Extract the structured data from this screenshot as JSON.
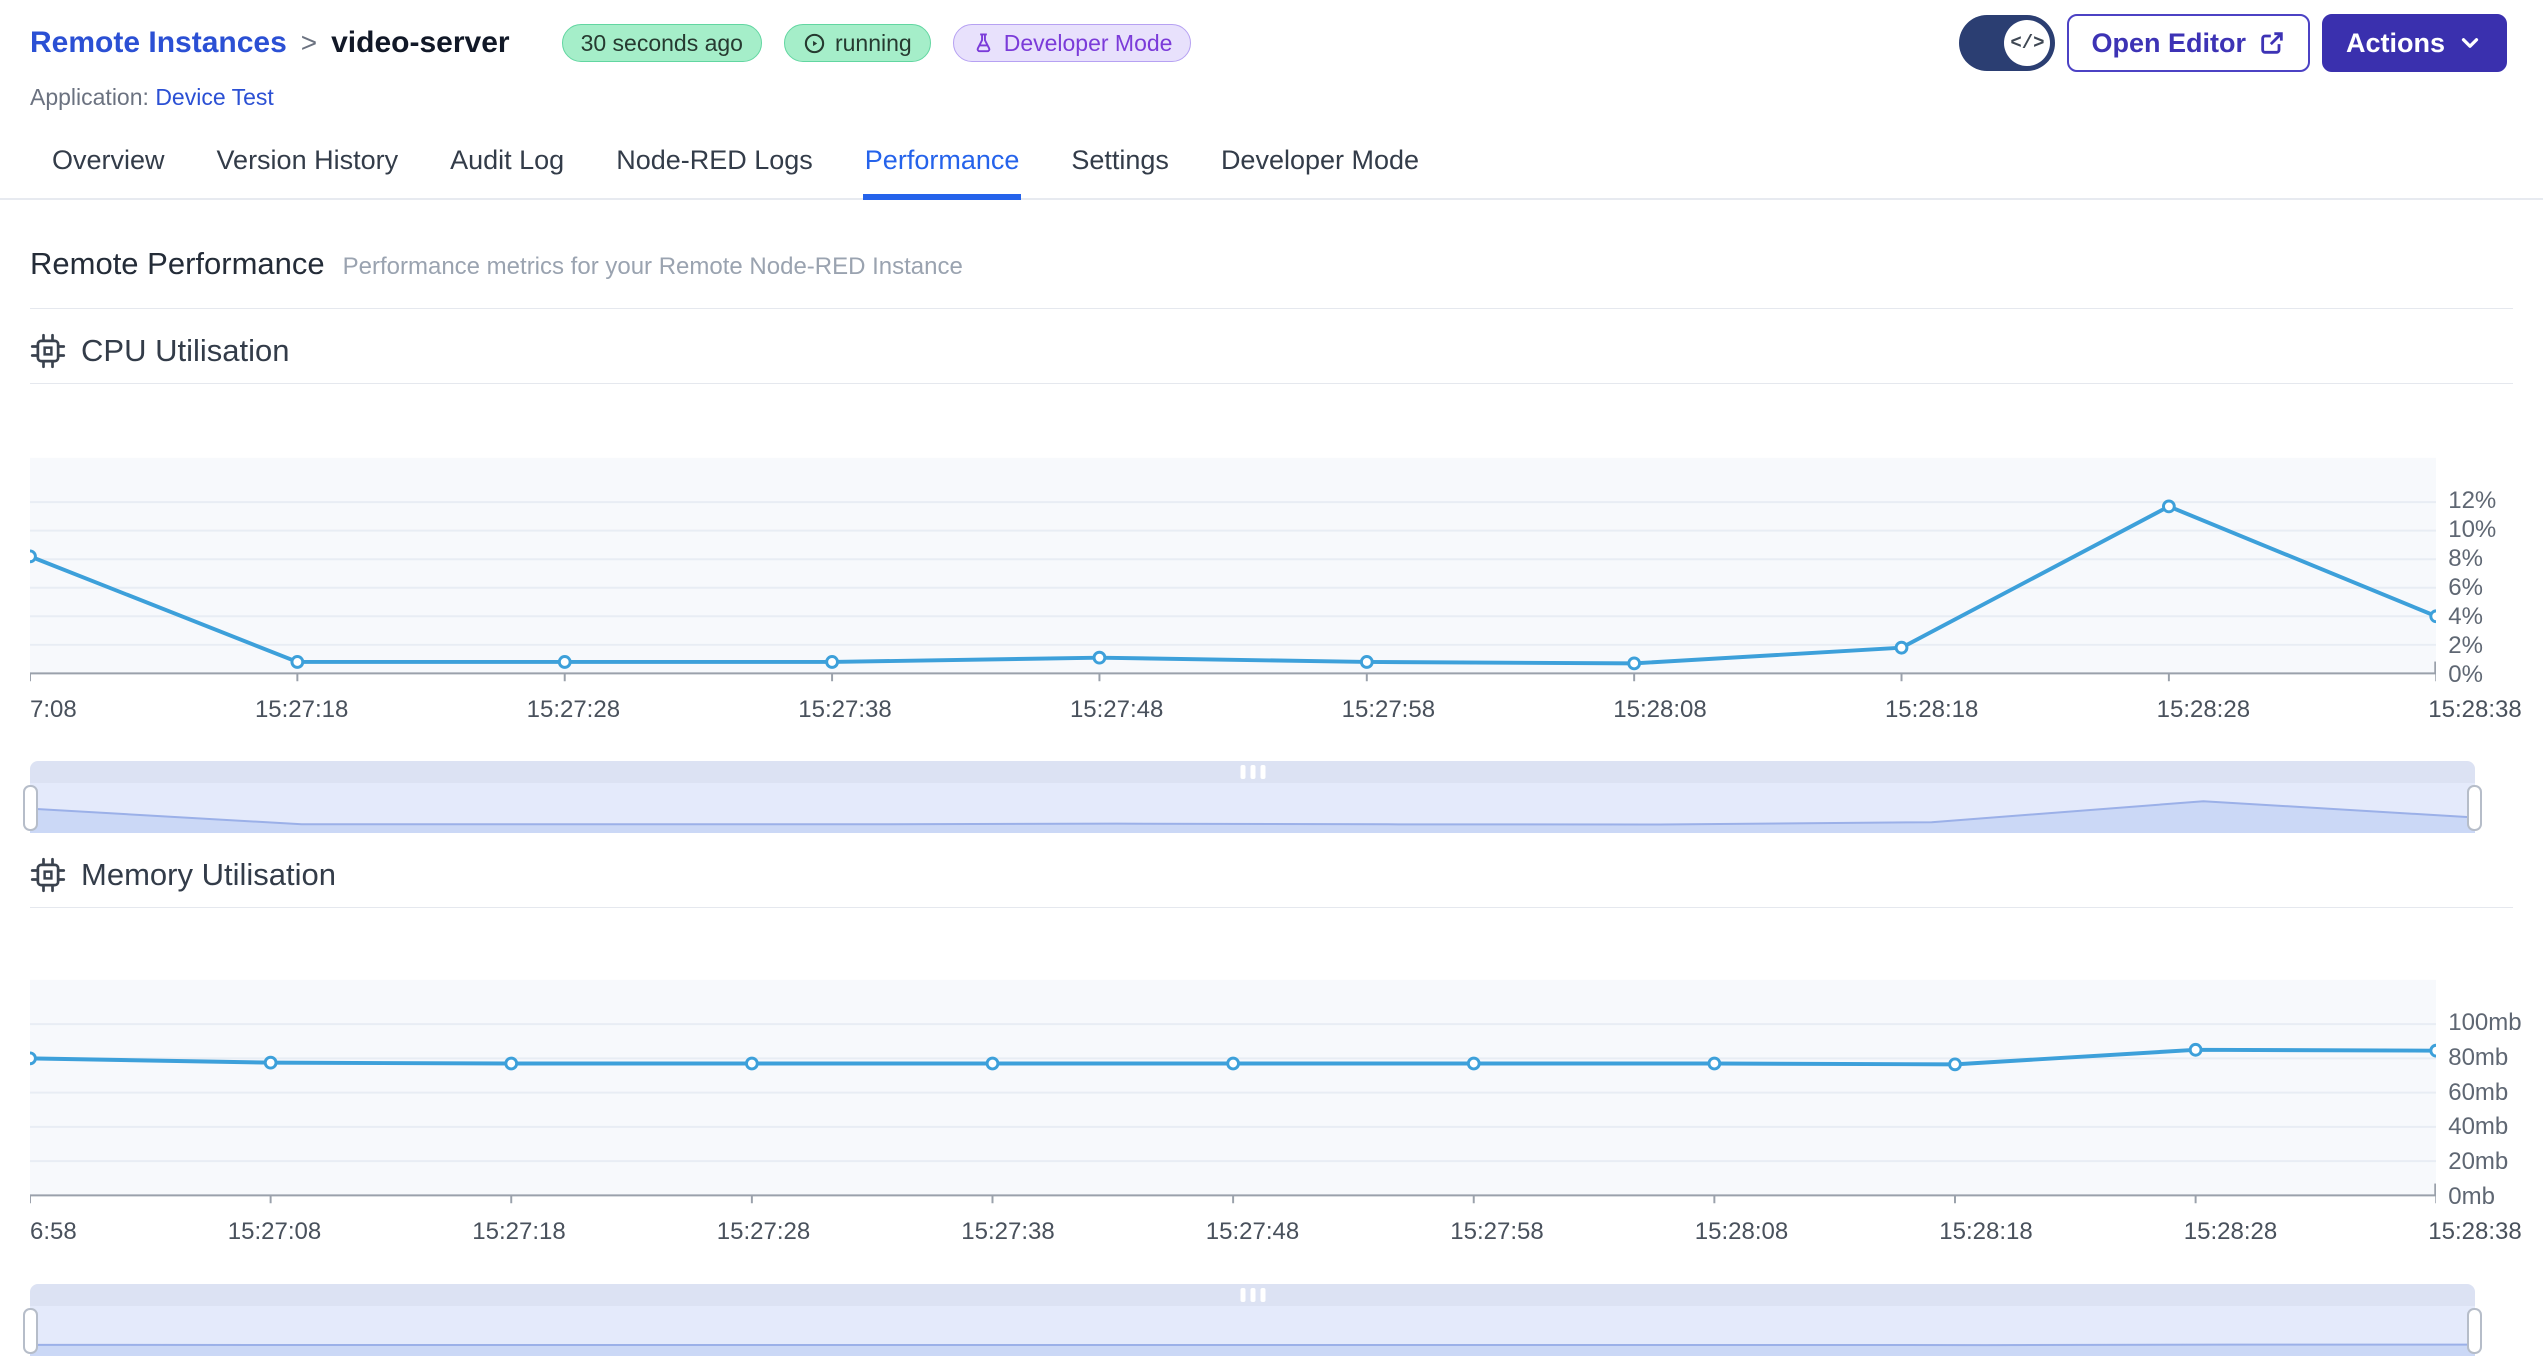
{
  "header": {
    "breadcrumb": {
      "parent": "Remote Instances",
      "separator": ">",
      "current": "video-server"
    },
    "badges": {
      "last_seen": "30 seconds ago",
      "status": "running",
      "mode": "Developer Mode"
    },
    "application_label": "Application:",
    "application_name": "Device Test",
    "open_editor_label": "Open Editor",
    "actions_label": "Actions"
  },
  "icons": {
    "toggle_code_glyph": "</>"
  },
  "tabs": [
    {
      "label": "Overview",
      "active": false
    },
    {
      "label": "Version History",
      "active": false
    },
    {
      "label": "Audit Log",
      "active": false
    },
    {
      "label": "Node-RED Logs",
      "active": false
    },
    {
      "label": "Performance",
      "active": true
    },
    {
      "label": "Settings",
      "active": false
    },
    {
      "label": "Developer Mode",
      "active": false
    }
  ],
  "page": {
    "title": "Remote Performance",
    "subtitle": "Performance metrics for your Remote Node-RED Instance"
  },
  "sections": {
    "cpu": {
      "title": "CPU Utilisation"
    },
    "memory": {
      "title": "Memory Utilisation"
    }
  },
  "chart_data": [
    {
      "id": "cpu",
      "type": "line",
      "title": "CPU Utilisation",
      "x_tick_labels": [
        "7:08",
        "15:27:18",
        "15:27:28",
        "15:27:38",
        "15:27:48",
        "15:27:58",
        "15:28:08",
        "15:28:18",
        "15:28:28",
        "15:28:38"
      ],
      "values": [
        8.2,
        0.8,
        0.8,
        0.8,
        1.1,
        0.8,
        0.7,
        1.8,
        11.7,
        4.0
      ],
      "unit": "%",
      "ylim": [
        0,
        12
      ],
      "y_ticks": [
        {
          "label": "12%",
          "value": 12
        },
        {
          "label": "10%",
          "value": 10
        },
        {
          "label": "8%",
          "value": 8
        },
        {
          "label": "6%",
          "value": 6
        },
        {
          "label": "4%",
          "value": 4
        },
        {
          "label": "2%",
          "value": 2
        },
        {
          "label": "0%",
          "value": 0
        }
      ],
      "grid": true,
      "legend": "none",
      "y_axis_position": "right",
      "line_color": "#3da0da",
      "plot_bg": "#f7f9fc",
      "grid_color": "#e8edf4",
      "axis_color": "#9aa1ab",
      "mini_ymax": 17,
      "mini_fill": "#cbd8f6",
      "mini_stroke": "#9bb0e8"
    },
    {
      "id": "memory",
      "type": "line",
      "title": "Memory Utilisation",
      "x_tick_labels": [
        "6:58",
        "15:27:08",
        "15:27:18",
        "15:27:28",
        "15:27:38",
        "15:27:48",
        "15:27:58",
        "15:28:08",
        "15:28:18",
        "15:28:28",
        "15:28:38"
      ],
      "values": [
        80,
        77.5,
        77,
        77,
        77,
        77,
        77,
        77,
        76.5,
        85,
        84.5
      ],
      "unit": "mb",
      "ylim": [
        0,
        100
      ],
      "y_ticks": [
        {
          "label": "100mb",
          "value": 100
        },
        {
          "label": "80mb",
          "value": 80
        },
        {
          "label": "60mb",
          "value": 60
        },
        {
          "label": "40mb",
          "value": 40
        },
        {
          "label": "20mb",
          "value": 20
        },
        {
          "label": "0mb",
          "value": 0
        }
      ],
      "grid": true,
      "legend": "none",
      "y_axis_position": "right",
      "line_color": "#3da0da",
      "plot_bg": "#f7f9fc",
      "grid_color": "#e8edf4",
      "axis_color": "#9aa1ab",
      "mini_ymax": 700,
      "mini_fill": "#cbd8f6",
      "mini_stroke": "#9bb0e8"
    }
  ]
}
